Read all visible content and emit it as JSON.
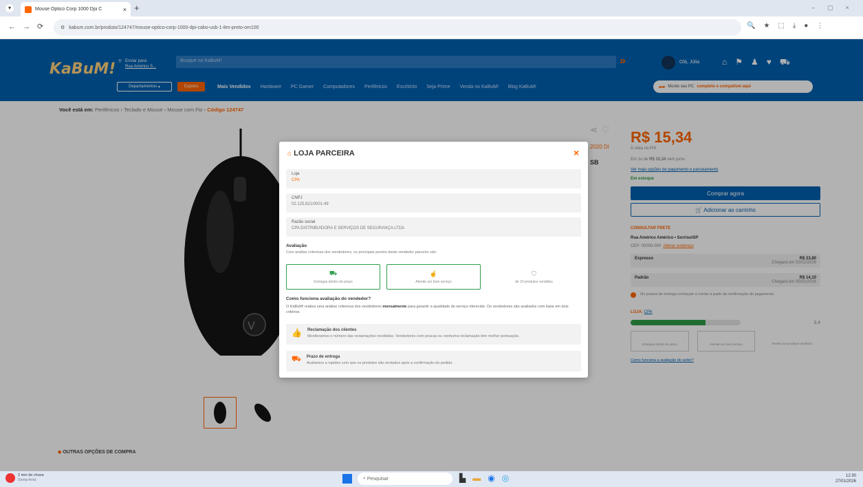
{
  "browser": {
    "tab_title": "Mouse Optico Corp 1000 Dpi C",
    "url": "kabum.com.br/produto/124747/mouse-optico-corp-1000-dpi-cabo-usb-1-8m-preto-om100"
  },
  "header": {
    "logo": "KaBuM!",
    "deliver_to": "Enviar para:",
    "deliver_city": "Rua Américo S...",
    "search_placeholder": "Busque no KaBuM!",
    "account": "Olá, Júlia",
    "departments": "Departamentos",
    "nav": [
      "Cupons",
      "Mais Vendidos",
      "Hardware",
      "PC Gamer",
      "Computadores",
      "Periféricos",
      "Escritório",
      "Seja Prime",
      "Venda no KaBuM!",
      "Blog KaBuM!"
    ],
    "promo_prefix": "Monte seu PC",
    "promo_highlight": "completo e compatível aqui"
  },
  "breadcrumb": {
    "prefix": "Você está em:",
    "path": "Periféricos › Teclado e Mouse › Mouse com Fio ›",
    "code": "Código 124747"
  },
  "product": {
    "price": "R$ 15,34",
    "price_note": "À vista no PIX",
    "installments_prefix": "Em 1x de",
    "installments_value": "R$ 15,34",
    "installments_suffix": "sem juros",
    "payment_link": "Ver mais opções de pagamento e parcelamento",
    "stock": "Em estoque",
    "buy_button": "Comprar agora",
    "cart_button": "Adicionar ao carrinho",
    "shipping_title": "CONSULTAR FRETE",
    "shipping_address": "Rua Américo Américo • Sorriso/SP",
    "cep": "CEP: 00000-000",
    "cep_link": "Alterar endereço",
    "shipping_options": [
      {
        "name": "Expresso",
        "price": "R$ 23,80",
        "eta": "Chegará em 02/02/2026"
      },
      {
        "name": "Padrão",
        "price": "R$ 14,10",
        "eta": "Chegará em 05/02/2026"
      }
    ],
    "shipping_note": "Os prazos de entrega começam a contar a partir da confirmação de pagamento.",
    "seller_label": "LOJA:",
    "seller_name": "CPA",
    "rating": "3,4",
    "rating_fraction": 0.68,
    "seller_features": [
      "Entregas dentro do prazo",
      "Atende um bom serviço",
      "Vendeu 10 produtos vendidos"
    ],
    "seller_link": "Como funciona a avaliação do seller?",
    "side_labels": [
      "2020 DI",
      "SB"
    ],
    "other_options": "OUTRAS OPÇÕES DE COMPRA"
  },
  "modal": {
    "title": "LOJA PARCEIRA",
    "store_label": "Loja",
    "store_value": "CPA",
    "cnpj_label": "CNPJ",
    "cnpj_value": "02.125.821/0001-49",
    "company_label": "Razão social",
    "company_value": "CPA DISTRIBUIDORA E SERVIÇOS DE SEGURANÇA LTDA",
    "rating_title": "Avaliação",
    "rating_desc": "Com análise criteriosa dos vendedores, os principais pontos deste vendedor parceiro são:",
    "cards": [
      "Entregas dentro do prazo",
      "Atende um bom serviço",
      "de 10 produtos vendidos"
    ],
    "how_title": "Como funciona avaliação do vendedor?",
    "how_desc_1": "O KaBuM! realiza uma análise criteriosa dos vendedores",
    "how_desc_bold": "mensalmente",
    "how_desc_2": "para garantir a qualidade do serviço oferecido. Os vendedores são avaliados com base em dois critérios:",
    "criteria": [
      {
        "title": "Reclamação dos clientes",
        "desc": "Monitoramos o número das reclamações recebidas. Vendedores com poucas ou nenhuma reclamação têm melhor pontuação."
      },
      {
        "title": "Prazo de entrega",
        "desc": "Avaliamos a rapidez com que os produtos são enviados após a confirmação do pedido."
      }
    ]
  },
  "taskbar": {
    "weather_temp": "2 mm de chuva",
    "weather_day": "Sexta-feira",
    "search": "Pesquisar",
    "time": "12:30",
    "date": "27/01/2026"
  },
  "colors": {
    "brand_blue": "#0060b1",
    "orange": "#ff6500",
    "green": "#2e9c4a"
  }
}
